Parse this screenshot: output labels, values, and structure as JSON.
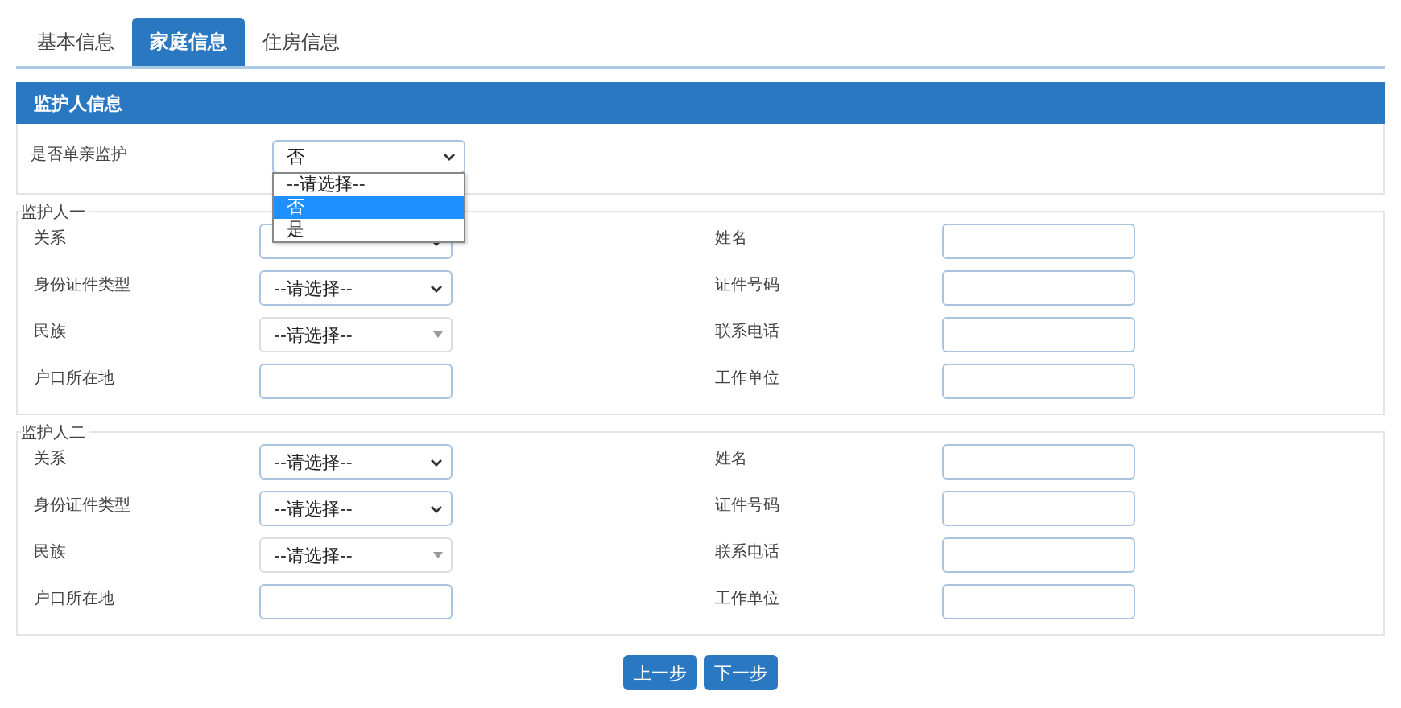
{
  "tabs": [
    {
      "label": "基本信息",
      "selected": false
    },
    {
      "label": "家庭信息",
      "selected": true
    },
    {
      "label": "住房信息",
      "selected": false
    }
  ],
  "panel": {
    "title": "监护人信息",
    "single_parent": {
      "label": "是否单亲监护",
      "value": "否",
      "expanded": true,
      "options": [
        {
          "label": "--请选择--",
          "selected": false
        },
        {
          "label": "否",
          "selected": true
        },
        {
          "label": "是",
          "selected": false
        }
      ]
    }
  },
  "guardians": [
    {
      "legend": "监护人一",
      "left": [
        {
          "label": "关系",
          "kind": "select"
        },
        {
          "label": "身份证件类型",
          "kind": "select",
          "value": "--请选择--"
        },
        {
          "label": "民族",
          "kind": "combo",
          "value": "--请选择--"
        },
        {
          "label": "户口所在地",
          "kind": "input"
        }
      ],
      "right": [
        {
          "label": "姓名"
        },
        {
          "label": "证件号码"
        },
        {
          "label": "联系电话"
        },
        {
          "label": "工作单位"
        }
      ]
    },
    {
      "legend": "监护人二",
      "left": [
        {
          "label": "关系",
          "kind": "select",
          "value": "--请选择--"
        },
        {
          "label": "身份证件类型",
          "kind": "select",
          "value": "--请选择--"
        },
        {
          "label": "民族",
          "kind": "combo",
          "value": "--请选择--"
        },
        {
          "label": "户口所在地",
          "kind": "input"
        }
      ],
      "right": [
        {
          "label": "姓名"
        },
        {
          "label": "证件号码"
        },
        {
          "label": "联系电话"
        },
        {
          "label": "工作单位"
        }
      ]
    }
  ],
  "buttons": [
    "上一步",
    "下一步"
  ]
}
